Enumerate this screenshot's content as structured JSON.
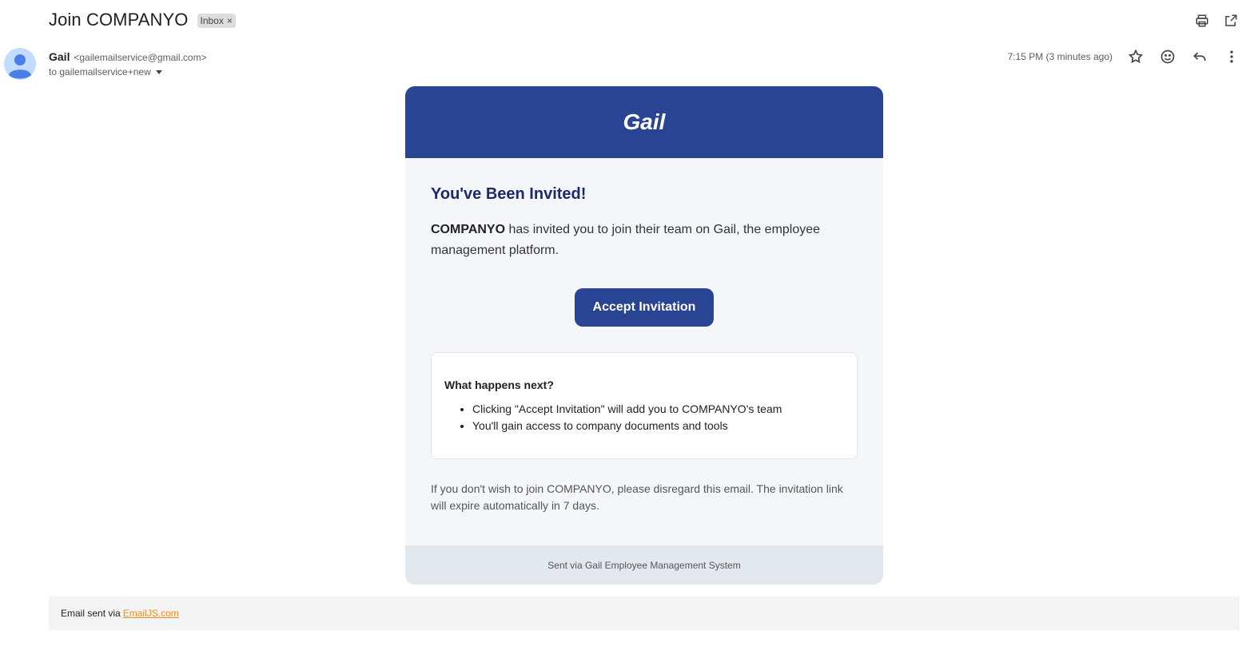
{
  "subject": "Join COMPANYO",
  "label_chip": {
    "text": "Inbox",
    "remove": "×"
  },
  "sender": {
    "name": "Gail",
    "email": "<gailemailservice@gmail.com>",
    "to": "to gailemailservice+new"
  },
  "timestamp": "7:15 PM (3 minutes ago)",
  "icons": {
    "print": "printer-icon",
    "popout": "open-in-new-icon",
    "star": "star-icon",
    "emoji": "emoji-icon",
    "reply": "reply-icon",
    "more": "more-vert-icon"
  },
  "card": {
    "brand": "Gail",
    "headline": "You've Been Invited!",
    "intro_company": "COMPANYO",
    "intro_rest": " has invited you to join their team on Gail, the employee management platform.",
    "cta": "Accept Invitation",
    "next_title": "What happens next?",
    "next_items": [
      "Clicking \"Accept Invitation\" will add you to COMPANYO's team",
      "You'll gain access to company documents and tools"
    ],
    "disregard": "If you don't wish to join COMPANYO, please disregard this email. The invitation link will expire automatically in 7 days.",
    "footer": "Sent via Gail Employee Management System"
  },
  "emailjs": {
    "prefix": "Email sent via",
    "link": "EmailJS.com"
  },
  "colors": {
    "brand_blue": "#2a4494",
    "headline_navy": "#1c2a6b",
    "link_orange": "#ef8b22"
  }
}
